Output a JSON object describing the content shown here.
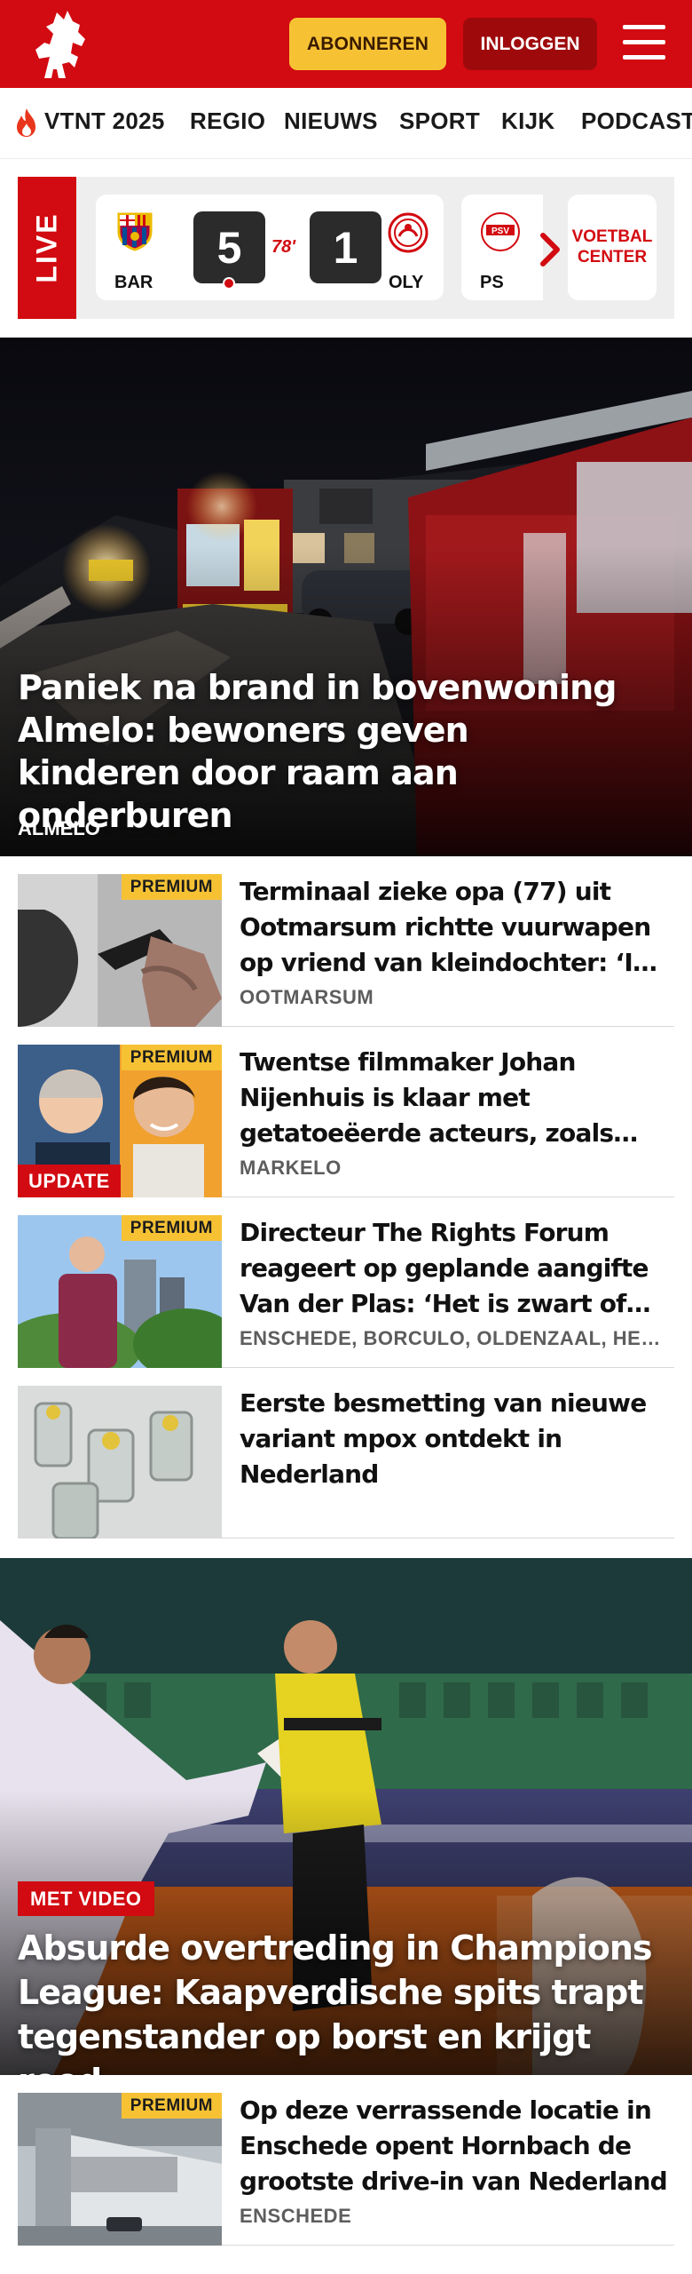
{
  "header": {
    "subscribe_label": "ABONNEREN",
    "login_label": "INLOGGEN"
  },
  "nav": {
    "items": [
      "VTNT 2025",
      "REGIO",
      "NIEUWS",
      "SPORT",
      "KIJK",
      "PODCAST"
    ]
  },
  "live": {
    "label": "LIVE",
    "match": {
      "home_code": "BAR",
      "home_score": "5",
      "minute": "78'",
      "away_score": "1",
      "away_code": "OLY"
    },
    "next_match_code": "PS",
    "voetbal_center_label": "VOETBAL CENTER"
  },
  "hero": {
    "title": "Paniek na brand in bovenwoning Almelo: bewoners geven kinderen door raam aan onderburen",
    "location": "ALMELO"
  },
  "articles": [
    {
      "title": "Terminaal zieke opa (77) uit Ootmarsum richtte vuurwapen op vriend van kleindochter: ‘Ik wilde hem bang maken’",
      "location": "OOTMARSUM",
      "badge": "PREMIUM"
    },
    {
      "title": "Twentse filmmaker Johan Nijenhuis is klaar met getatoeëerde acteurs, zoals Thijs Römer",
      "location": "MARKELO",
      "badge": "PREMIUM",
      "tag": "UPDATE"
    },
    {
      "title": "Directeur The Rights Forum reageert op geplande aangifte Van der Plas: ‘Het is zwart of wit’",
      "location": "ENSCHEDE, BORCULO, OLDENZAAL, HENGELO",
      "badge": "PREMIUM"
    },
    {
      "title": "Eerste besmetting van nieuwe variant mpox ontdekt in Nederland",
      "location": ""
    }
  ],
  "hero2": {
    "badge": "MET VIDEO",
    "title": "Absurde overtreding in Champions League: Kaapverdische spits trapt tegenstander op borst en krijgt rood"
  },
  "articles2": [
    {
      "title": "Op deze verrassende locatie in Enschede opent Hornbach de grootste drive-in van Nederland",
      "location": "ENSCHEDE",
      "badge": "PREMIUM"
    }
  ],
  "colors": {
    "brand_red": "#d20a11",
    "premium_yellow": "#f6c234",
    "login_dark_red": "#9e0a0c"
  },
  "icons": [
    "tubantia-horse-logo",
    "hamburger-menu-icon",
    "flame-icon",
    "barcelona-crest",
    "olympiakos-crest",
    "psv-crest",
    "chevron-right-icon"
  ]
}
